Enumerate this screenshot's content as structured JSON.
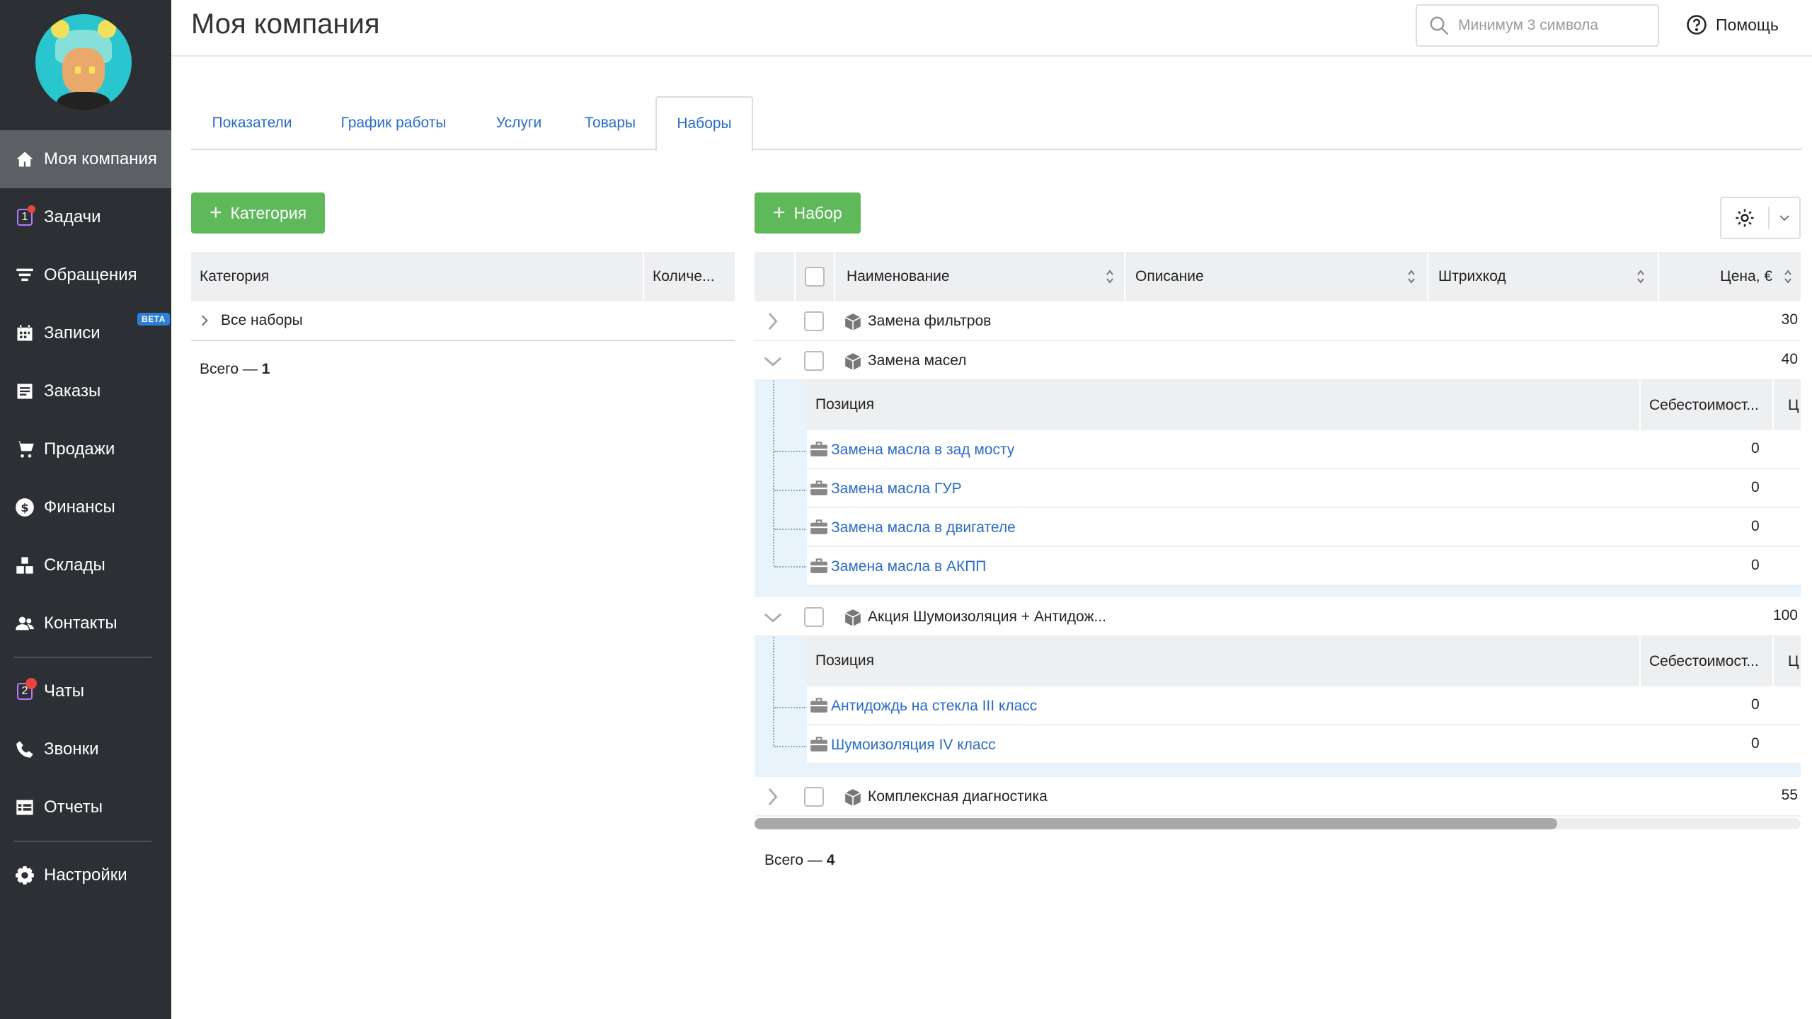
{
  "app": {
    "page_title": "Моя компания"
  },
  "header": {
    "search_placeholder": "Минимум 3 символа",
    "help_label": "Помощь"
  },
  "sidebar": {
    "items": [
      {
        "label": "Моя компания",
        "icon": "home-icon",
        "active": true
      },
      {
        "label": "Задачи",
        "icon": "tasks-icon",
        "badge": "1"
      },
      {
        "label": "Обращения",
        "icon": "funnel-icon"
      },
      {
        "label": "Записи",
        "icon": "calendar-icon",
        "beta": "BETA"
      },
      {
        "label": "Заказы",
        "icon": "orders-icon"
      },
      {
        "label": "Продажи",
        "icon": "cart-icon"
      },
      {
        "label": "Финансы",
        "icon": "dollar-icon"
      },
      {
        "label": "Склады",
        "icon": "boxes-icon"
      },
      {
        "label": "Контакты",
        "icon": "contacts-icon"
      },
      {
        "label": "Чаты",
        "icon": "chats-icon",
        "badge": "2"
      },
      {
        "label": "Звонки",
        "icon": "phone-icon"
      },
      {
        "label": "Отчеты",
        "icon": "reports-icon"
      },
      {
        "label": "Настройки",
        "icon": "gear-icon"
      }
    ]
  },
  "tabs": [
    {
      "label": "Показатели"
    },
    {
      "label": "График работы"
    },
    {
      "label": "Услуги"
    },
    {
      "label": "Товары"
    },
    {
      "label": "Наборы",
      "active": true
    }
  ],
  "categories": {
    "add_button": "Категория",
    "columns": [
      "Категория",
      "Количе..."
    ],
    "rows": [
      {
        "name": "Все наборы"
      }
    ],
    "total_label": "Всего —",
    "total_value": "1"
  },
  "sets": {
    "add_button": "Набор",
    "columns": [
      "Наименование",
      "Описание",
      "Штрихкод",
      "Цена, €"
    ],
    "sub_columns": [
      "Позиция",
      "Себестоимост...",
      "Ц"
    ],
    "rows": [
      {
        "name": "Замена фильтров",
        "price": "30",
        "expanded": false
      },
      {
        "name": "Замена масел",
        "price": "40",
        "expanded": true,
        "items": [
          {
            "name": "Замена масла в зад мосту",
            "cost": "0"
          },
          {
            "name": "Замена масла ГУР",
            "cost": "0"
          },
          {
            "name": "Замена масла в двигателе",
            "cost": "0"
          },
          {
            "name": "Замена масла в АКПП",
            "cost": "0"
          }
        ]
      },
      {
        "name": "Акция Шумоизоляция + Антидож...",
        "price": "100",
        "expanded": true,
        "items": [
          {
            "name": "Антидождь на стекла III класс",
            "cost": "0"
          },
          {
            "name": "Шумоизоляция IV класс",
            "cost": "0"
          }
        ]
      },
      {
        "name": "Комплексная диагностика",
        "price": "55",
        "expanded": false
      }
    ],
    "total_label": "Всего —",
    "total_value": "4"
  },
  "colors": {
    "accent_green": "#5fb85a",
    "link_blue": "#2a6cc4",
    "sidebar_bg": "#2c2f33"
  }
}
